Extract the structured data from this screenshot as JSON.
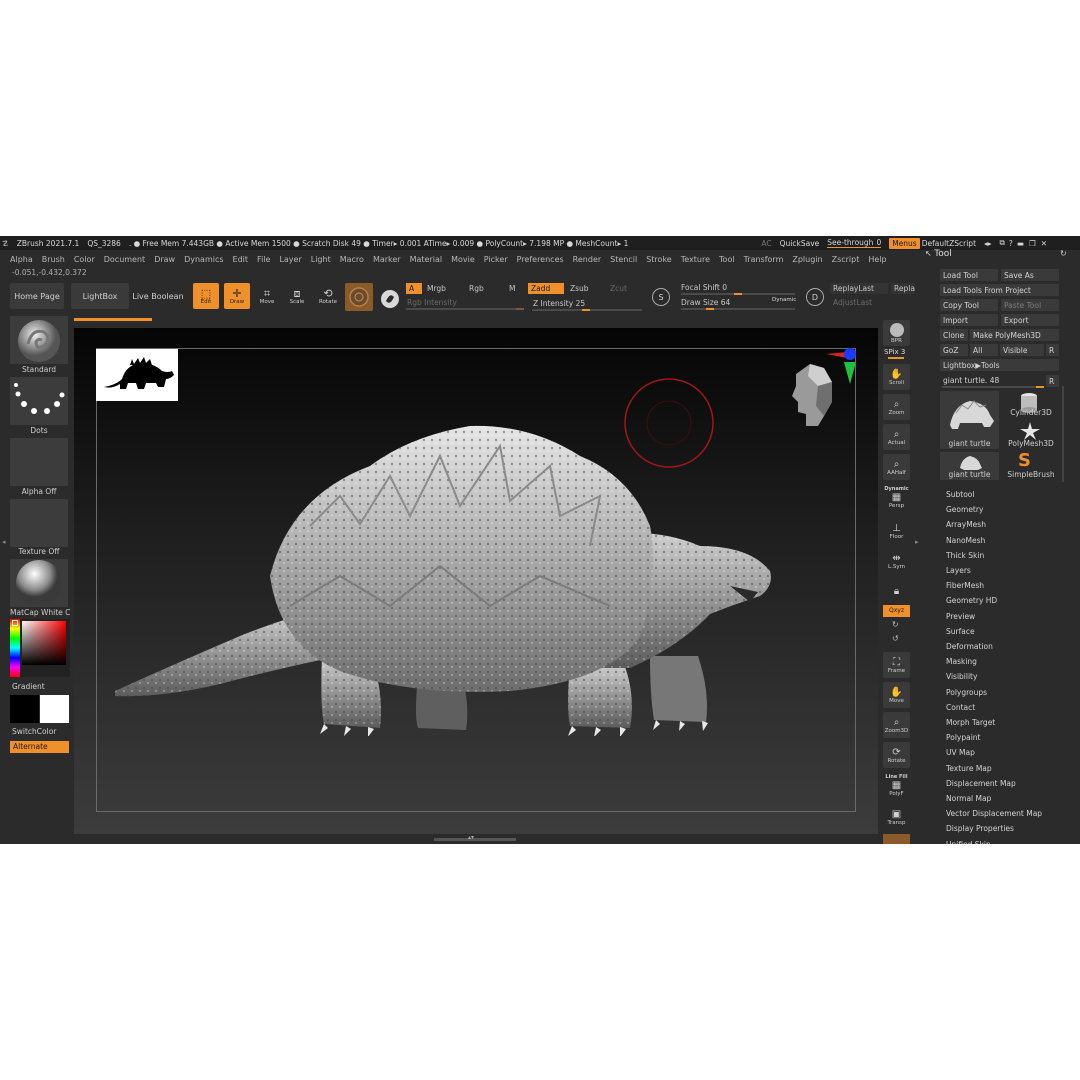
{
  "title_bar": {
    "app": "ZBrush 2021.7.1",
    "document": "QS_3286",
    "stats": ". ● Free Mem 7.443GB ● Active Mem 1500 ● Scratch Disk 49 ●  Timer▸ 0.001 ATime▸ 0.009 ● PolyCount▸ 7.198 MP  ● MeshCount▸ 1",
    "ac": "AC",
    "quicksave": "QuickSave",
    "see_through_label": "See-through",
    "see_through_value": "0",
    "menus": "Menus",
    "script": "DefaultZScript"
  },
  "menu_bar": [
    "Alpha",
    "Brush",
    "Color",
    "Document",
    "Draw",
    "Dynamics",
    "Edit",
    "File",
    "Layer",
    "Light",
    "Macro",
    "Marker",
    "Material",
    "Movie",
    "Picker",
    "Preferences",
    "Render",
    "Stencil",
    "Stroke",
    "Texture",
    "Tool",
    "Transform",
    "Zplugin",
    "Zscript",
    "Help"
  ],
  "coordinates": "-0.051,-0.432,0.372",
  "shelf": {
    "home_page": "Home Page",
    "lightbox": "LightBox",
    "live_boolean": "Live Boolean",
    "edit": "Edit",
    "draw": "Draw",
    "move": "Move",
    "scale": "Scale",
    "rotate": "Rotate",
    "a": "A",
    "mrgb": "Mrgb",
    "rgb": "Rgb",
    "m": "M",
    "rgb_intensity": "Rgb Intensity",
    "zadd": "Zadd",
    "zsub": "Zsub",
    "zcut": "Zcut",
    "z_intensity_label": "Z Intensity",
    "z_intensity_value": "25",
    "s_label": "S",
    "d_label": "D",
    "focal_shift_label": "Focal Shift",
    "focal_shift_value": "0",
    "draw_size_label": "Draw Size",
    "draw_size_value": "64",
    "dynamic": "Dynamic",
    "replay_last": "ReplayLast",
    "replay_short": "Repla",
    "adjust_last": "AdjustLast"
  },
  "left_panel": {
    "brush": "Standard",
    "stroke": "Dots",
    "alpha": "Alpha Off",
    "texture": "Texture Off",
    "material": "MatCap White C",
    "gradient": "Gradient",
    "switch_color": "SwitchColor",
    "alternate": "Alternate"
  },
  "right_column": {
    "bpr": "BPR",
    "spix_label": "SPix",
    "spix_value": "3",
    "scroll": "Scroll",
    "zoom": "Zoom",
    "actual": "Actual",
    "aahalf": "AAHalf",
    "dynamic": "Dynamic",
    "persp": "Persp",
    "floor": "Floor",
    "lsym": "L.Sym",
    "xyz": "Qxyz",
    "frame": "Frame",
    "move": "Move",
    "zoom3d": "Zoom3D",
    "rotate": "Rotate",
    "line_fill": "Line Fill",
    "polyf": "PolyF",
    "transp": "Transp"
  },
  "tool_palette": {
    "title": "Tool",
    "load_tool": "Load Tool",
    "save_as": "Save As",
    "load_from_project": "Load Tools From Project",
    "copy_tool": "Copy Tool",
    "paste_tool": "Paste Tool",
    "import": "Import",
    "export": "Export",
    "clone": "Clone",
    "make_polymesh": "Make PolyMesh3D",
    "goz": "GoZ",
    "all": "All",
    "visible": "Visible",
    "r": "R",
    "lightbox_tools": "Lightbox▶Tools",
    "current_tool_label": "giant turtle.",
    "current_tool_value": "48",
    "thumbnails": [
      "giant turtle",
      "Cylinder3D",
      "PolyMesh3D",
      "giant turtle",
      "SimpleBrush"
    ],
    "subpalettes": [
      "Subtool",
      "Geometry",
      "ArrayMesh",
      "NanoMesh",
      "Thick Skin",
      "Layers",
      "FiberMesh",
      "Geometry HD",
      "Preview",
      "Surface",
      "Deformation",
      "Masking",
      "Visibility",
      "Polygroups",
      "Contact",
      "Morph Target",
      "Polypaint",
      "UV Map",
      "Texture Map",
      "Displacement Map",
      "Normal Map",
      "Vector Displacement Map",
      "Display Properties",
      "Unified Skin"
    ]
  },
  "colors": {
    "accent": "#f0902a",
    "panel": "#2b2b2b",
    "button": "#3a3a3a"
  }
}
